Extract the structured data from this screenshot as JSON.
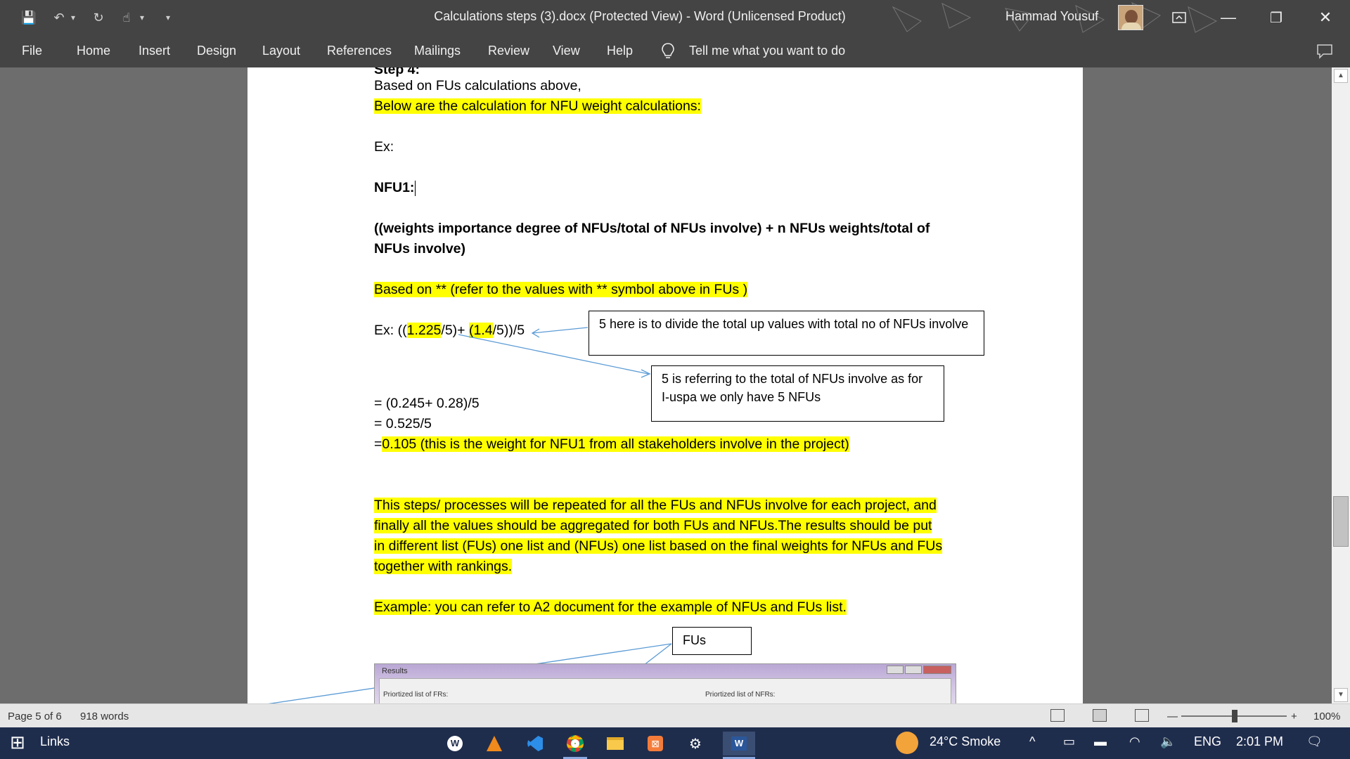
{
  "window": {
    "title": "Calculations steps (3).docx (Protected View)  -  Word (Unlicensed Product)",
    "user_name": "Hammad Yousuf",
    "minimize": "—",
    "restore": "❐",
    "close": "✕"
  },
  "quick_access": {
    "save": "💾",
    "undo": "↶",
    "redo": "↻",
    "touch": "☝",
    "customize": "▾"
  },
  "ribbon": {
    "tabs": [
      "File",
      "Home",
      "Insert",
      "Design",
      "Layout",
      "References",
      "Mailings",
      "Review",
      "View",
      "Help"
    ],
    "tell_me": "Tell me what you want to do",
    "bulb": "💡",
    "comment_icon": "🗨"
  },
  "document": {
    "lines": {
      "step": "Step 4:",
      "based_fus": "Based on FUs calculations above,",
      "below": "Below are the calculation for  NFU weight calculations:",
      "ex": "Ex:",
      "nfu1": "NFU1:",
      "formula1": "((weights importance degree of NFUs/total of NFUs involve) + n NFUs weights/total of",
      "formula2": "NFUs involve)",
      "based_on": "Based on ** (refer to the values with ** symbol above in FUs )",
      "ex2_a": "Ex: ((",
      "ex2_b": "1.225",
      "ex2_c": "/5)+ ",
      "ex2_d": "(1.4",
      "ex2_e": "/5))/5",
      "calc1": "= (0.245+ 0.28)/5",
      "calc2": "= 0.525/5",
      "calc3_a": "=",
      "calc3_b": "0.105 (this is the weight for NFU1 from all stakeholders involve in the project)",
      "para1": "This steps/ processes will be repeated for all the FUs and NFUs involve for each project, and",
      "para2": "finally all the values should be aggregated for both FUs and NFUs.The results should be put",
      "para3": "in different list (FUs) one list and (NFUs) one list based on the final weights for NFUs and FUs",
      "para4": "together with rankings.",
      "example": "Example: you can refer to A2 document for the example of NFUs and FUs list."
    },
    "callouts": {
      "c1": "5 here is to divide the total up values with total no of NFUs involve",
      "c2": "5 is referring to the total of NFUs involve as for I-uspa we only have 5 NFUs",
      "c3": "FUs"
    },
    "embedded": {
      "title": "Results",
      "left_label": "Priortized list of FRs:",
      "right_label": "Priortized list of NFRs:"
    }
  },
  "status": {
    "page": "Page 5 of 6",
    "words": "918 words",
    "zoom_minus": "—",
    "zoom_plus": "+",
    "zoom": "100%"
  },
  "taskbar": {
    "start_icon": "⊞",
    "search": "Links",
    "weather": "24°C  Smoke",
    "lang": "ENG",
    "time": "2:01 PM",
    "chevron": "^",
    "notifications": "🗨"
  }
}
